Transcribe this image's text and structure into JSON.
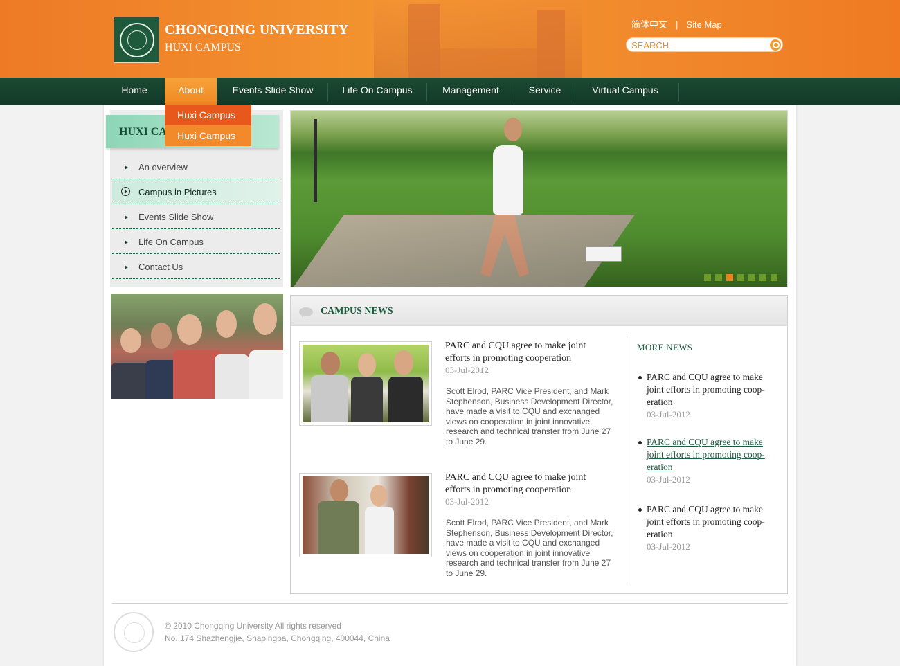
{
  "header": {
    "university": "CHONGQING UNIVERSITY",
    "campus": "HUXI CAMPUS",
    "lang_link": "简体中文",
    "separator": "|",
    "sitemap_link": "Site Map",
    "search_placeholder": "SEARCH",
    "icons": [
      "university-seal",
      "search-icon"
    ]
  },
  "nav": {
    "items": [
      {
        "label": "Home"
      },
      {
        "label": "About",
        "active": true
      },
      {
        "label": "Events Slide Show"
      },
      {
        "label": "Life On Campus"
      },
      {
        "label": "Management"
      },
      {
        "label": "Service"
      },
      {
        "label": "Virtual  Campus"
      }
    ],
    "dropdown": [
      "Huxi Campus",
      "Huxi Campus"
    ]
  },
  "sidebar": {
    "title": "HUXI CA",
    "items": [
      {
        "label": "An overview"
      },
      {
        "label": "Campus in Pictures",
        "selected": true
      },
      {
        "label": "Events Slide Show"
      },
      {
        "label": "Life On Campus"
      },
      {
        "label": "Contact Us"
      }
    ]
  },
  "slideshow": {
    "dot_count": 7,
    "active_dot": 3
  },
  "news": {
    "title": "CAMPUS NEWS",
    "articles": [
      {
        "title": "PARC and CQU agree to make joint efforts in promoting cooperation",
        "date": "03-Jul-2012",
        "body": "Scott Elrod, PARC Vice President, and Mark Stephenson, Business Development Director, have made a visit to CQU and exchanged views on cooperation in joint innovative research and technical transfer from June 27 to June 29."
      },
      {
        "title": "PARC and CQU agree to make joint efforts in promoting cooperation",
        "date": "03-Jul-2012",
        "body": "Scott Elrod, PARC Vice President, and Mark Stephenson, Business Development Director, have made a visit to CQU and exchanged views on cooperation in joint innovative research and technical transfer from June 27 to June 29."
      }
    ],
    "more_title": "MORE  NEWS",
    "more_items": [
      {
        "title": "PARC and CQU agree to make joint efforts in promoting coop-eration",
        "date": "03-Jul-2012"
      },
      {
        "title": "PARC and CQU agree to make joint efforts in promoting coop-eration",
        "date": "03-Jul-2012",
        "hover": true
      },
      {
        "title": "PARC and CQU agree to make joint efforts in promoting coop-eration",
        "date": "03-Jul-2012"
      }
    ]
  },
  "footer": {
    "copyright": "© 2010 Chongqing University All rights reserved",
    "address": "No. 174 Shazhengjie, Shapingba, Chongqing, 400044, China"
  },
  "colors": {
    "header_orange": "#f39530",
    "nav_green": "#1b4a31",
    "accent_orange": "#f08822",
    "dropdown_red": "#e8581c",
    "title_green": "#1e5c3e"
  }
}
